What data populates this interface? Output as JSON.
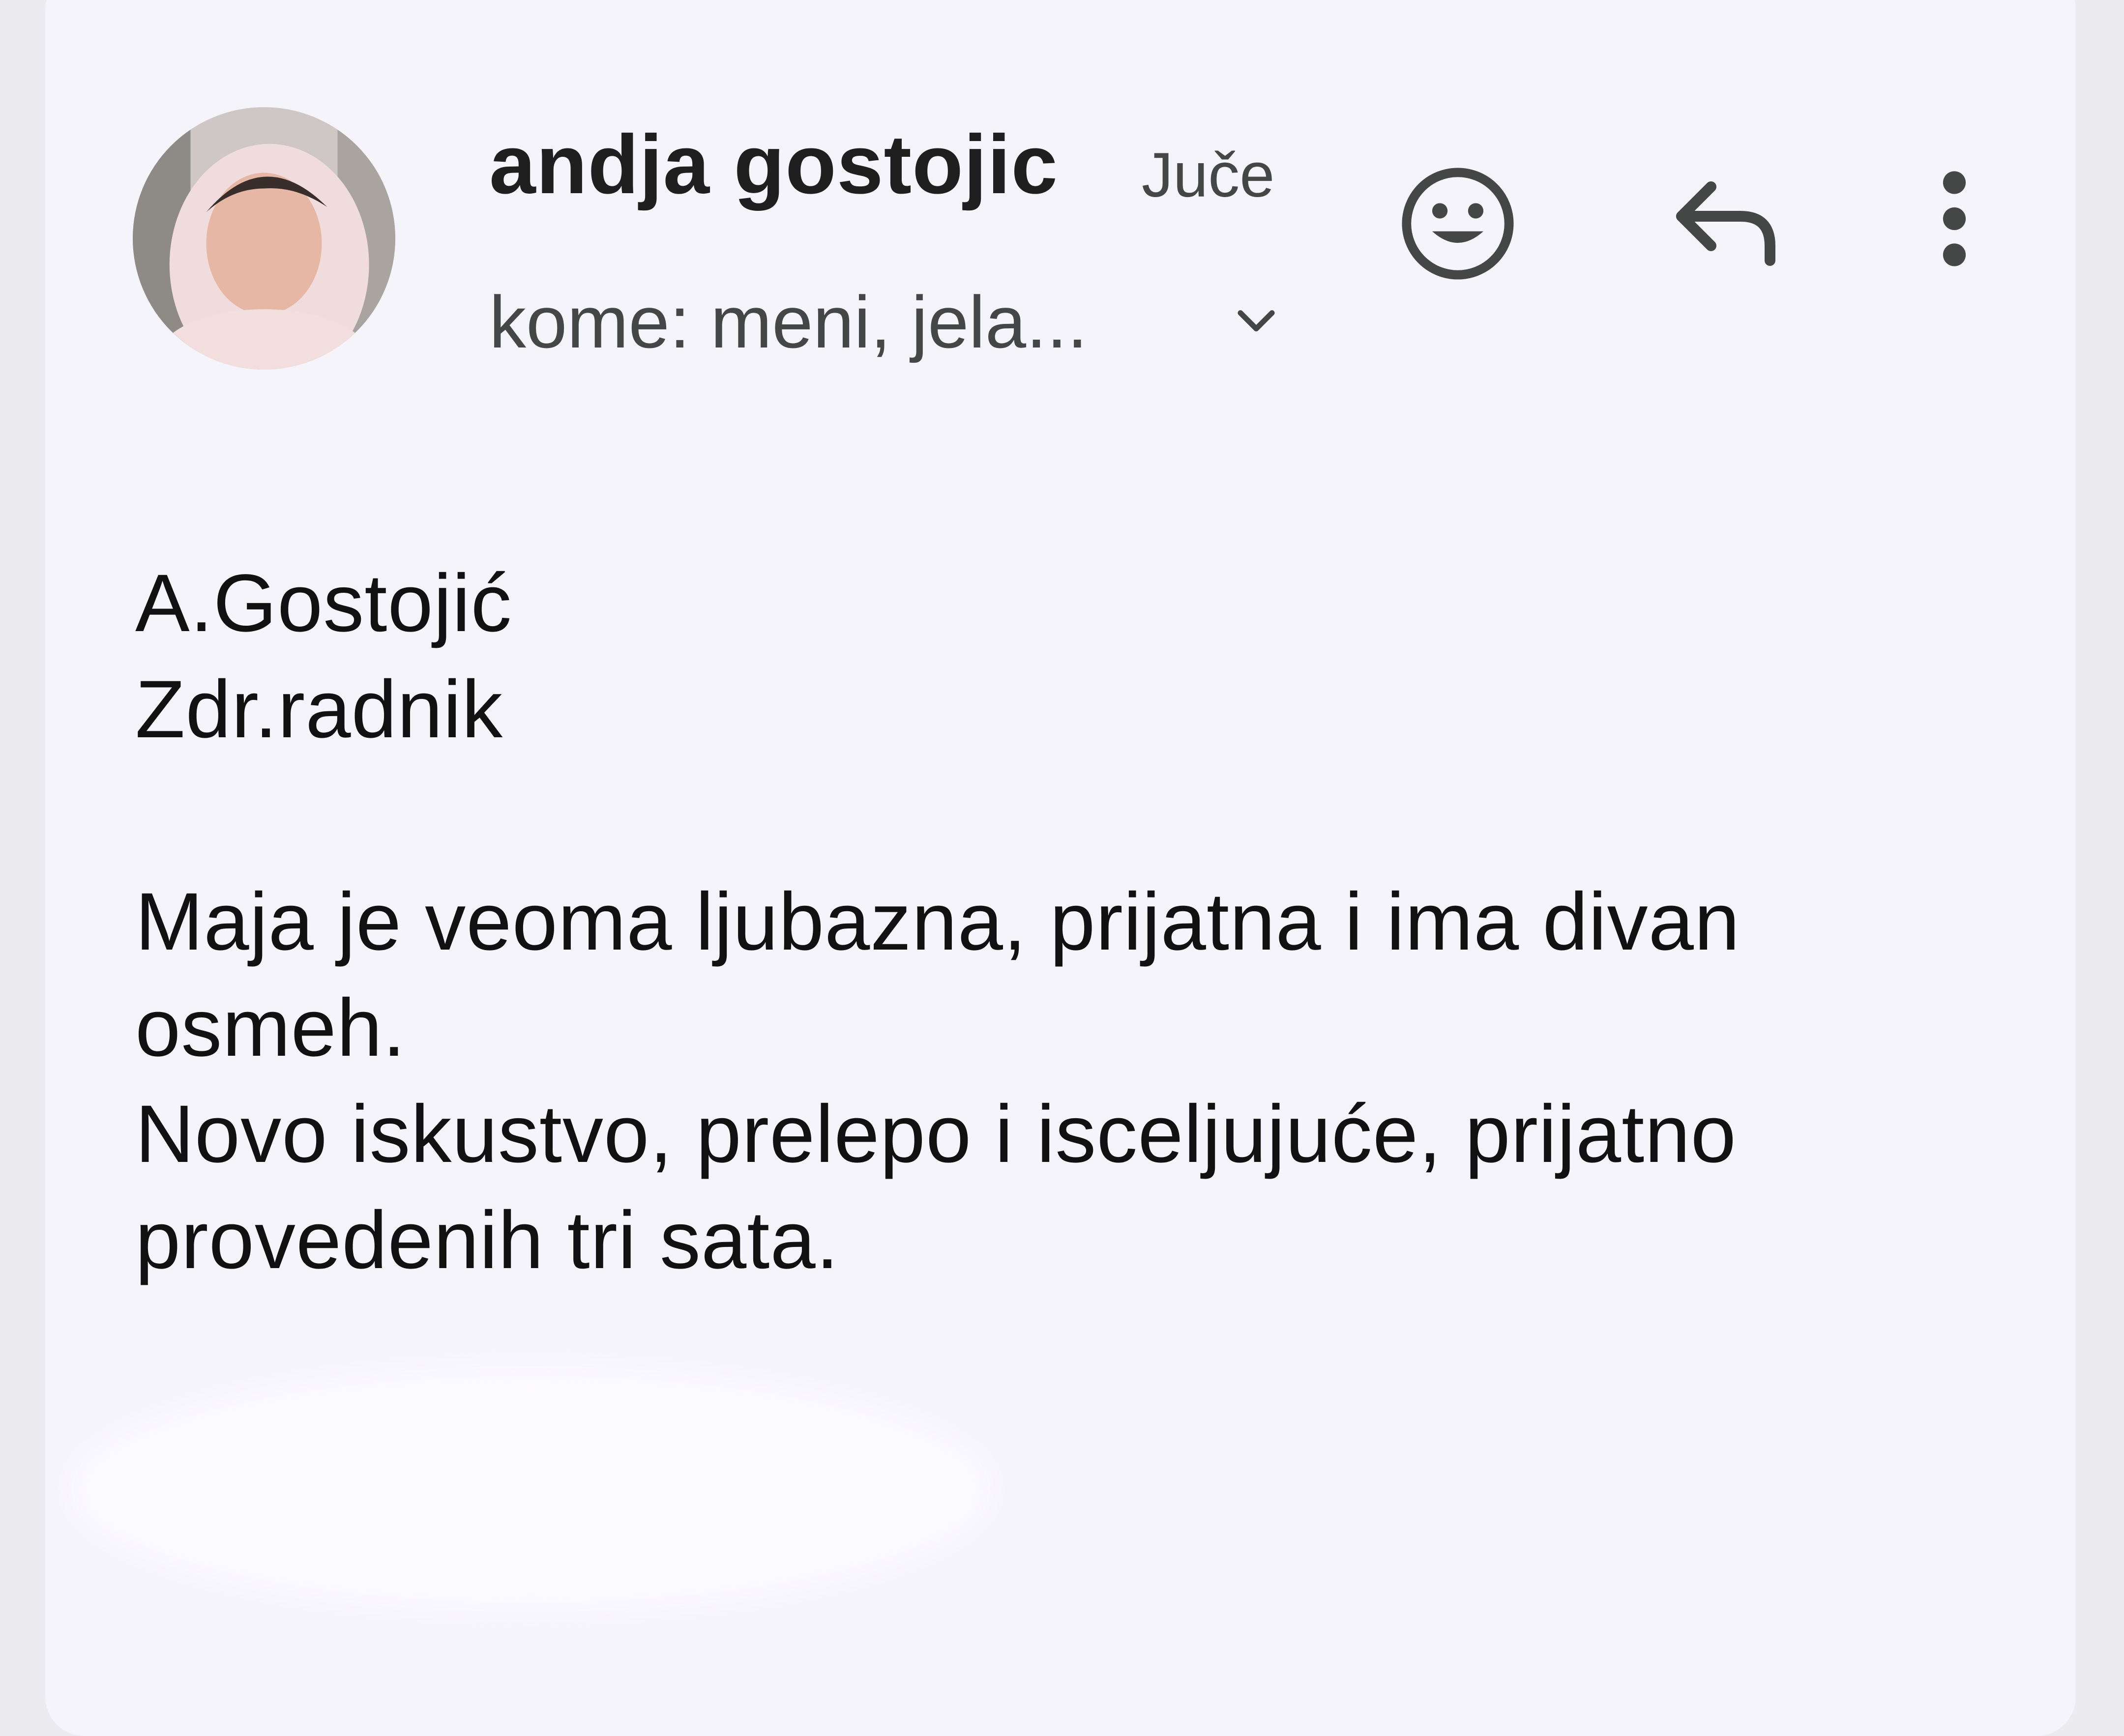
{
  "email": {
    "sender_name": "andja gostojic",
    "date": "Juče",
    "recipients": "kome: meni, jela...",
    "body": {
      "signature_lines": [
        "A.Gostojić",
        "Zdr.radnik"
      ],
      "paragraph_lines": [
        "Maja je veoma ljubazna, prijatna i ima divan",
        "osmeh.",
        "Novo iskustvo, prelepo i isceljujuće, prijatno",
        "provedenih tri sata."
      ]
    }
  },
  "icons": {
    "emoji": "smiley-face-icon",
    "reply": "reply-arrow-icon",
    "more": "vertical-dots-icon",
    "expand": "chevron-down-icon"
  },
  "colors": {
    "card_background": "#f6f4fb",
    "page_background": "#ebebf0",
    "icon": "#444746",
    "text": "#111111"
  }
}
